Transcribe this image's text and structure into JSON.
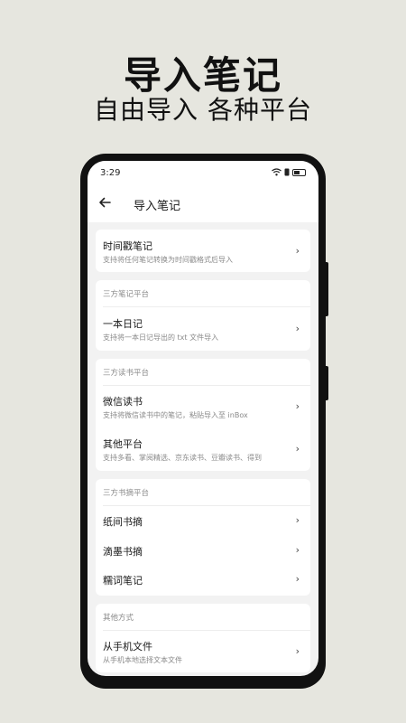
{
  "promo": {
    "title": "导入笔记",
    "subtitle": "自由导入 各种平台"
  },
  "status": {
    "time": "3:29"
  },
  "appbar": {
    "title": "导入笔记"
  },
  "sections": {
    "timestamp": {
      "title": "时间戳笔记",
      "desc": "支持将任何笔记转换为时间戳格式后导入"
    },
    "diary": {
      "label": "三方笔记平台",
      "items": [
        {
          "title": "一本日记",
          "desc": "支持将一本日记导出的 txt 文件导入"
        }
      ]
    },
    "reading": {
      "label": "三方读书平台",
      "items": [
        {
          "title": "微信读书",
          "desc": "支持将微信读书中的笔记，粘贴导入至 inBox"
        },
        {
          "title": "其他平台",
          "desc": "支持多看、掌阅精选、京东读书、豆瓣读书、得到"
        }
      ]
    },
    "excerpt": {
      "label": "三方书摘平台",
      "items": [
        {
          "title": "纸间书摘"
        },
        {
          "title": "滴墨书摘"
        },
        {
          "title": "糯词笔记"
        }
      ]
    },
    "other": {
      "label": "其他方式",
      "items": [
        {
          "title": "从手机文件",
          "desc": "从手机本地选择文本文件"
        }
      ]
    }
  },
  "icons": {
    "back": "arrow-left-icon",
    "chevron": "chevron-right-icon",
    "wifi": "wifi-icon",
    "battery": "battery-icon"
  },
  "colors": {
    "background": "#e6e6df",
    "screen": "#f2f2f2",
    "card": "#ffffff",
    "secondary_text": "#8a8a8a"
  }
}
